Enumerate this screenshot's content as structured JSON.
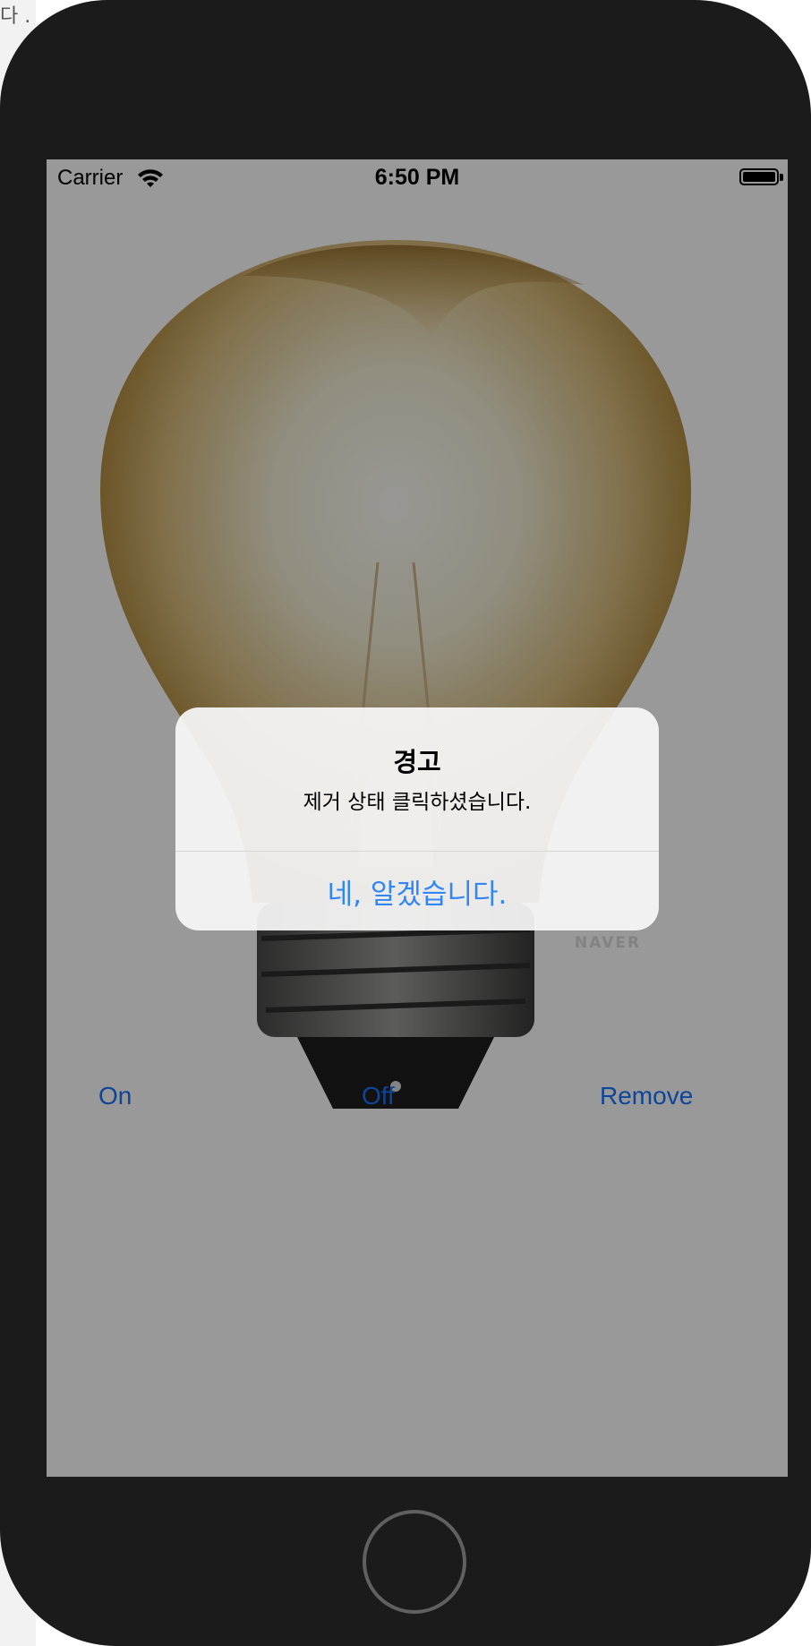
{
  "behind": {
    "corner_text": "다 ."
  },
  "status_bar": {
    "carrier": "Carrier",
    "time": "6:50 PM",
    "wifi_icon": "wifi-icon",
    "battery_icon": "battery-full-icon"
  },
  "image": {
    "watermark": "NAVER"
  },
  "controls": {
    "on_label": "On",
    "off_label": "Off",
    "remove_label": "Remove"
  },
  "alert": {
    "title": "경고",
    "message": "제거 상태 클릭하셨습니다.",
    "action_label": "네, 알겠습니다."
  },
  "colors": {
    "device_frame": "#1b1b1b",
    "accent_blue": "#2f86f6",
    "dim_overlay": "rgba(0,0,0,0.40)"
  }
}
